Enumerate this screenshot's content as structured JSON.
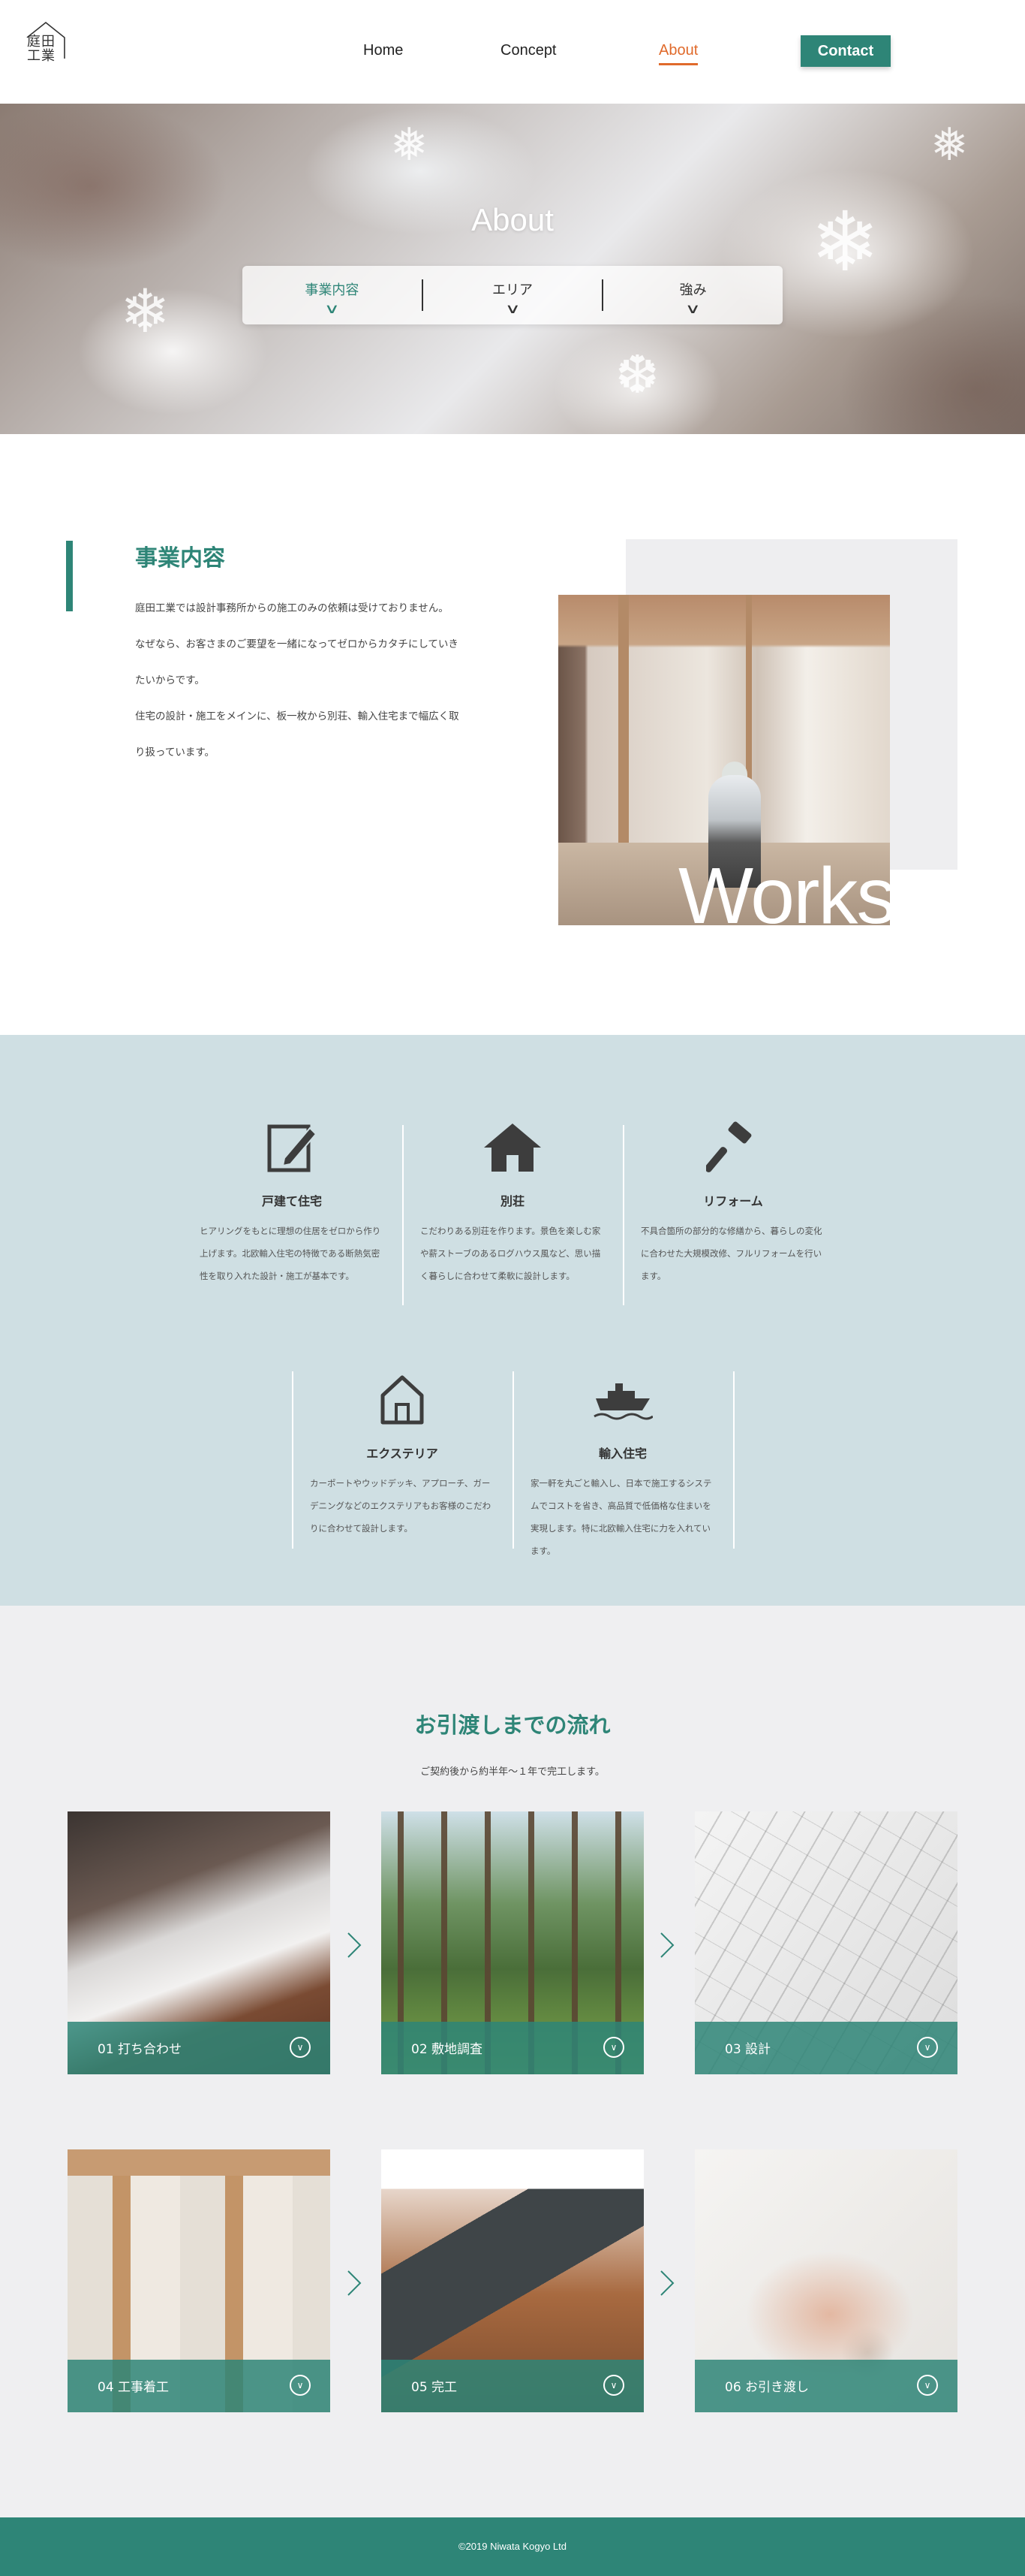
{
  "header": {
    "logo_text": "庭田工業",
    "nav": [
      {
        "label": "Home"
      },
      {
        "label": "Concept"
      },
      {
        "label": "About",
        "active": true
      }
    ],
    "contact_label": "Contact"
  },
  "hero": {
    "title": "About",
    "subnav": [
      {
        "label": "事業内容",
        "active": true
      },
      {
        "label": "エリア"
      },
      {
        "label": "強み"
      }
    ]
  },
  "business": {
    "title": "事業内容",
    "paragraphs": [
      "庭田工業では設計事務所からの施工のみの依頼は受けておりません。",
      "なぜなら、お客さまのご要望を一緒になってゼロからカタチにしていきたいからです。",
      "住宅の設計・施工をメインに、板一枚から別荘、輸入住宅まで幅広く取り扱っています。"
    ],
    "photo_caption": "Works"
  },
  "services": [
    {
      "icon": "edit-icon",
      "title": "戸建て住宅",
      "text": "ヒアリングをもとに理想の住居をゼロから作り上げます。北欧輸入住宅の特徴である断熱気密性を取り入れた設計・施工が基本です。"
    },
    {
      "icon": "house-icon",
      "title": "別荘",
      "text": "こだわりある別荘を作ります。景色を楽しむ家や薪ストーブのあるログハウス風など、思い描く暮らしに合わせて柔軟に設計します。"
    },
    {
      "icon": "hammer-icon",
      "title": "リフォーム",
      "text": "不具合箇所の部分的な修繕から、暮らしの変化に合わせた大規模改修、フルリフォームを行います。"
    },
    {
      "icon": "house-outline-icon",
      "title": "エクステリア",
      "text": "カーポートやウッドデッキ、アプローチ、ガーデニングなどのエクステリアもお客様のこだわりに合わせて設計します。"
    },
    {
      "icon": "ship-icon",
      "title": "輸入住宅",
      "text": "家一軒を丸ごと輸入し、日本で施工するシステムでコストを省き、高品質で低価格な住まいを実現します。特に北欧輸入住宅に力を入れています。"
    }
  ],
  "flow": {
    "title": "お引渡しまでの流れ",
    "subtitle": "ご契約後から約半年〜１年で完工します。",
    "steps": [
      {
        "label": "01 打ち合わせ"
      },
      {
        "label": "02 敷地調査"
      },
      {
        "label": "03 設計"
      },
      {
        "label": "04 工事着工"
      },
      {
        "label": "05 完工"
      },
      {
        "label": "06 お引き渡し"
      }
    ]
  },
  "footer": {
    "copyright": "©2019 Niwata Kogyo Ltd"
  },
  "colors": {
    "accent": "#2e8577",
    "nav_active": "#e06a2b",
    "services_bg": "#cfdfe3",
    "flow_bg": "#efeff1"
  }
}
